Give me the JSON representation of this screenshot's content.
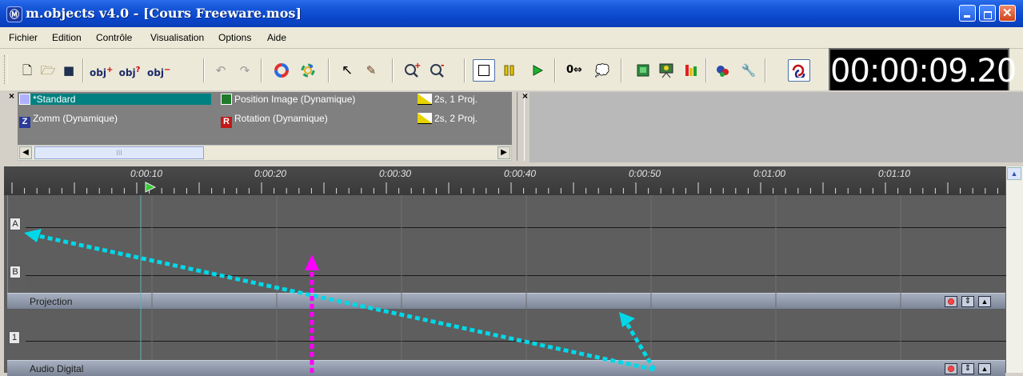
{
  "window": {
    "title": "m.objects v4.0 - [Cours Freeware.mos]",
    "app_icon": "m-objects-logo-icon",
    "controls": [
      "minimize-icon",
      "restore-icon",
      "close-icon"
    ]
  },
  "menu": {
    "items": [
      "Fichier",
      "Edition",
      "Contrôle",
      "Visualisation",
      "Options",
      "Aide"
    ]
  },
  "toolbar": {
    "buttons": [
      "new-file-icon",
      "open-folder-icon",
      "save-icon",
      "add-object-icon",
      "object-info-icon",
      "remove-object-icon",
      "undo-icon",
      "redo-icon",
      "color-wheel-icon",
      "color-palette-icon",
      "select-arrow-icon",
      "eyedropper-icon",
      "zoom-in-icon",
      "zoom-out-icon",
      "stop-icon",
      "pause-icon",
      "play-icon",
      "goto-zero-icon",
      "speech-bubble-icon",
      "image-icon",
      "presentation-icon",
      "levels-icon",
      "objects-icon",
      "wrench-icon",
      "loop-icon"
    ],
    "obj_labels": [
      "obj",
      "obj",
      "obj"
    ],
    "goto_zero_label": "0⇔"
  },
  "timecode": "00:00:09.20",
  "library": {
    "items": [
      {
        "label": "*Standard",
        "icon": "standard-effect-icon",
        "selected": true
      },
      {
        "label": "Zomm (Dynamique)",
        "icon": "zoom-effect-icon"
      },
      {
        "label": "Position Image (Dynamique)",
        "icon": "position-effect-icon"
      },
      {
        "label": "Rotation (Dynamique)",
        "icon": "rotation-effect-icon"
      },
      {
        "label": "2s, 1 Proj.",
        "icon": "fade-curve-icon"
      },
      {
        "label": "2s, 2 Proj.",
        "icon": "fade-curve-icon"
      }
    ],
    "scroll_thumb_label": "III"
  },
  "timeline": {
    "ruler_labels": [
      "0:00:10",
      "0:00:20",
      "0:00:30",
      "0:00:40",
      "0:00:50",
      "0:01:00",
      "0:01:10"
    ],
    "tracks": [
      "A",
      "B",
      "1"
    ],
    "bands": [
      "Projection",
      "Audio Digital"
    ]
  },
  "colors": {
    "titlebar": "#0a45c9",
    "selection": "#008080",
    "timeline_bg": "#5e5e5e",
    "arrow_cyan": "#00d8e8",
    "arrow_magenta": "#ff00ff",
    "playhead": "#3cc83c"
  }
}
